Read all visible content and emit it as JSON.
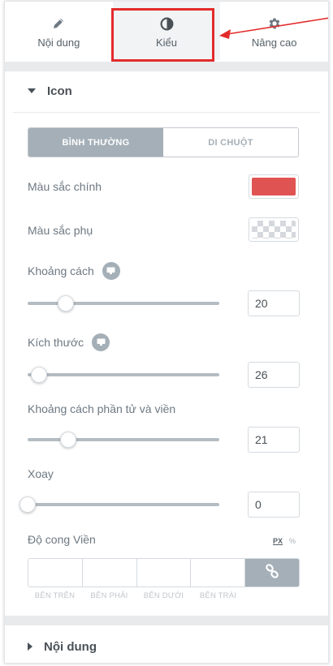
{
  "tabs": [
    {
      "label": "Nội dung",
      "icon": "pencil-icon"
    },
    {
      "label": "Kiểu",
      "icon": "half-circle-icon"
    },
    {
      "label": "Nâng cao",
      "icon": "gear-icon"
    }
  ],
  "active_tab": "Kiểu",
  "section_icon": {
    "title": "Icon"
  },
  "state_toggle": {
    "normal": "BÌNH THƯỜNG",
    "hover": "DI CHUỘT",
    "selected": "BÌNH THƯỜNG"
  },
  "primary_color": {
    "label": "Màu sắc chính",
    "value": "#e05353"
  },
  "secondary_color": {
    "label": "Màu sắc phụ",
    "value": "transparent"
  },
  "spacing": {
    "label": "Khoảng cách",
    "value": "20",
    "fraction": 0.2
  },
  "size": {
    "label": "Kích thước",
    "value": "26",
    "fraction": 0.06
  },
  "padding": {
    "label": "Khoảng cách phần tử và viền",
    "value": "21",
    "fraction": 0.21
  },
  "rotate": {
    "label": "Xoay",
    "value": "0",
    "fraction": 0.0
  },
  "border_radius": {
    "label": "Độ cong Viền",
    "unit_px": "PX",
    "unit_pct": "%",
    "top": "BÊN TRÊN",
    "right": "BÊN PHẢI",
    "bottom": "BÊN DƯỚI",
    "left": "BÊN TRÁI",
    "link_icon": "link-icon"
  },
  "section_content": {
    "title": "Nội dung"
  },
  "colors": {
    "accent_highlight": "#e32b2b",
    "toggle_active": "#a4afb7"
  }
}
